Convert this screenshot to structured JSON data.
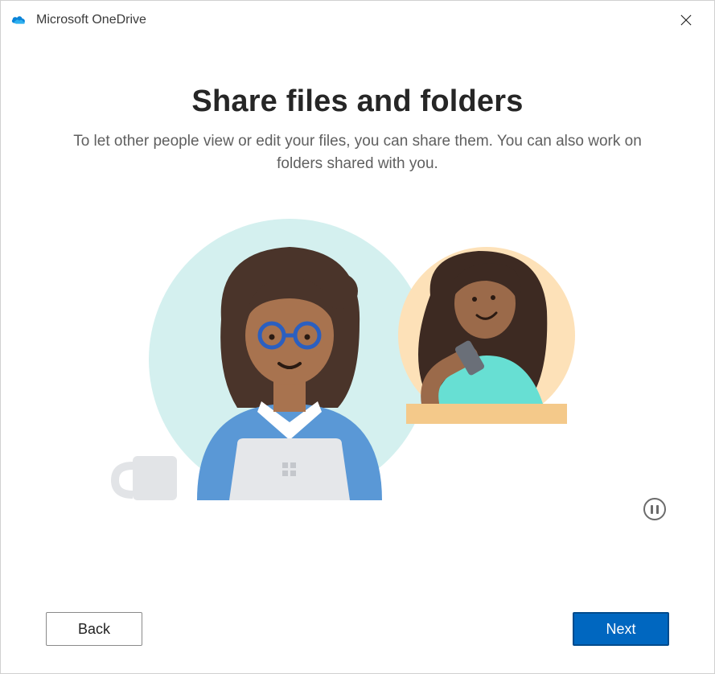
{
  "app": {
    "title": "Microsoft OneDrive"
  },
  "page": {
    "heading": "Share files and folders",
    "subtitle": "To let other people view or edit your files, you can share them. You can also work on folders shared with you."
  },
  "buttons": {
    "back": "Back",
    "next": "Next"
  },
  "icons": {
    "close": "close",
    "pause": "pause",
    "onedrive": "onedrive-cloud"
  }
}
